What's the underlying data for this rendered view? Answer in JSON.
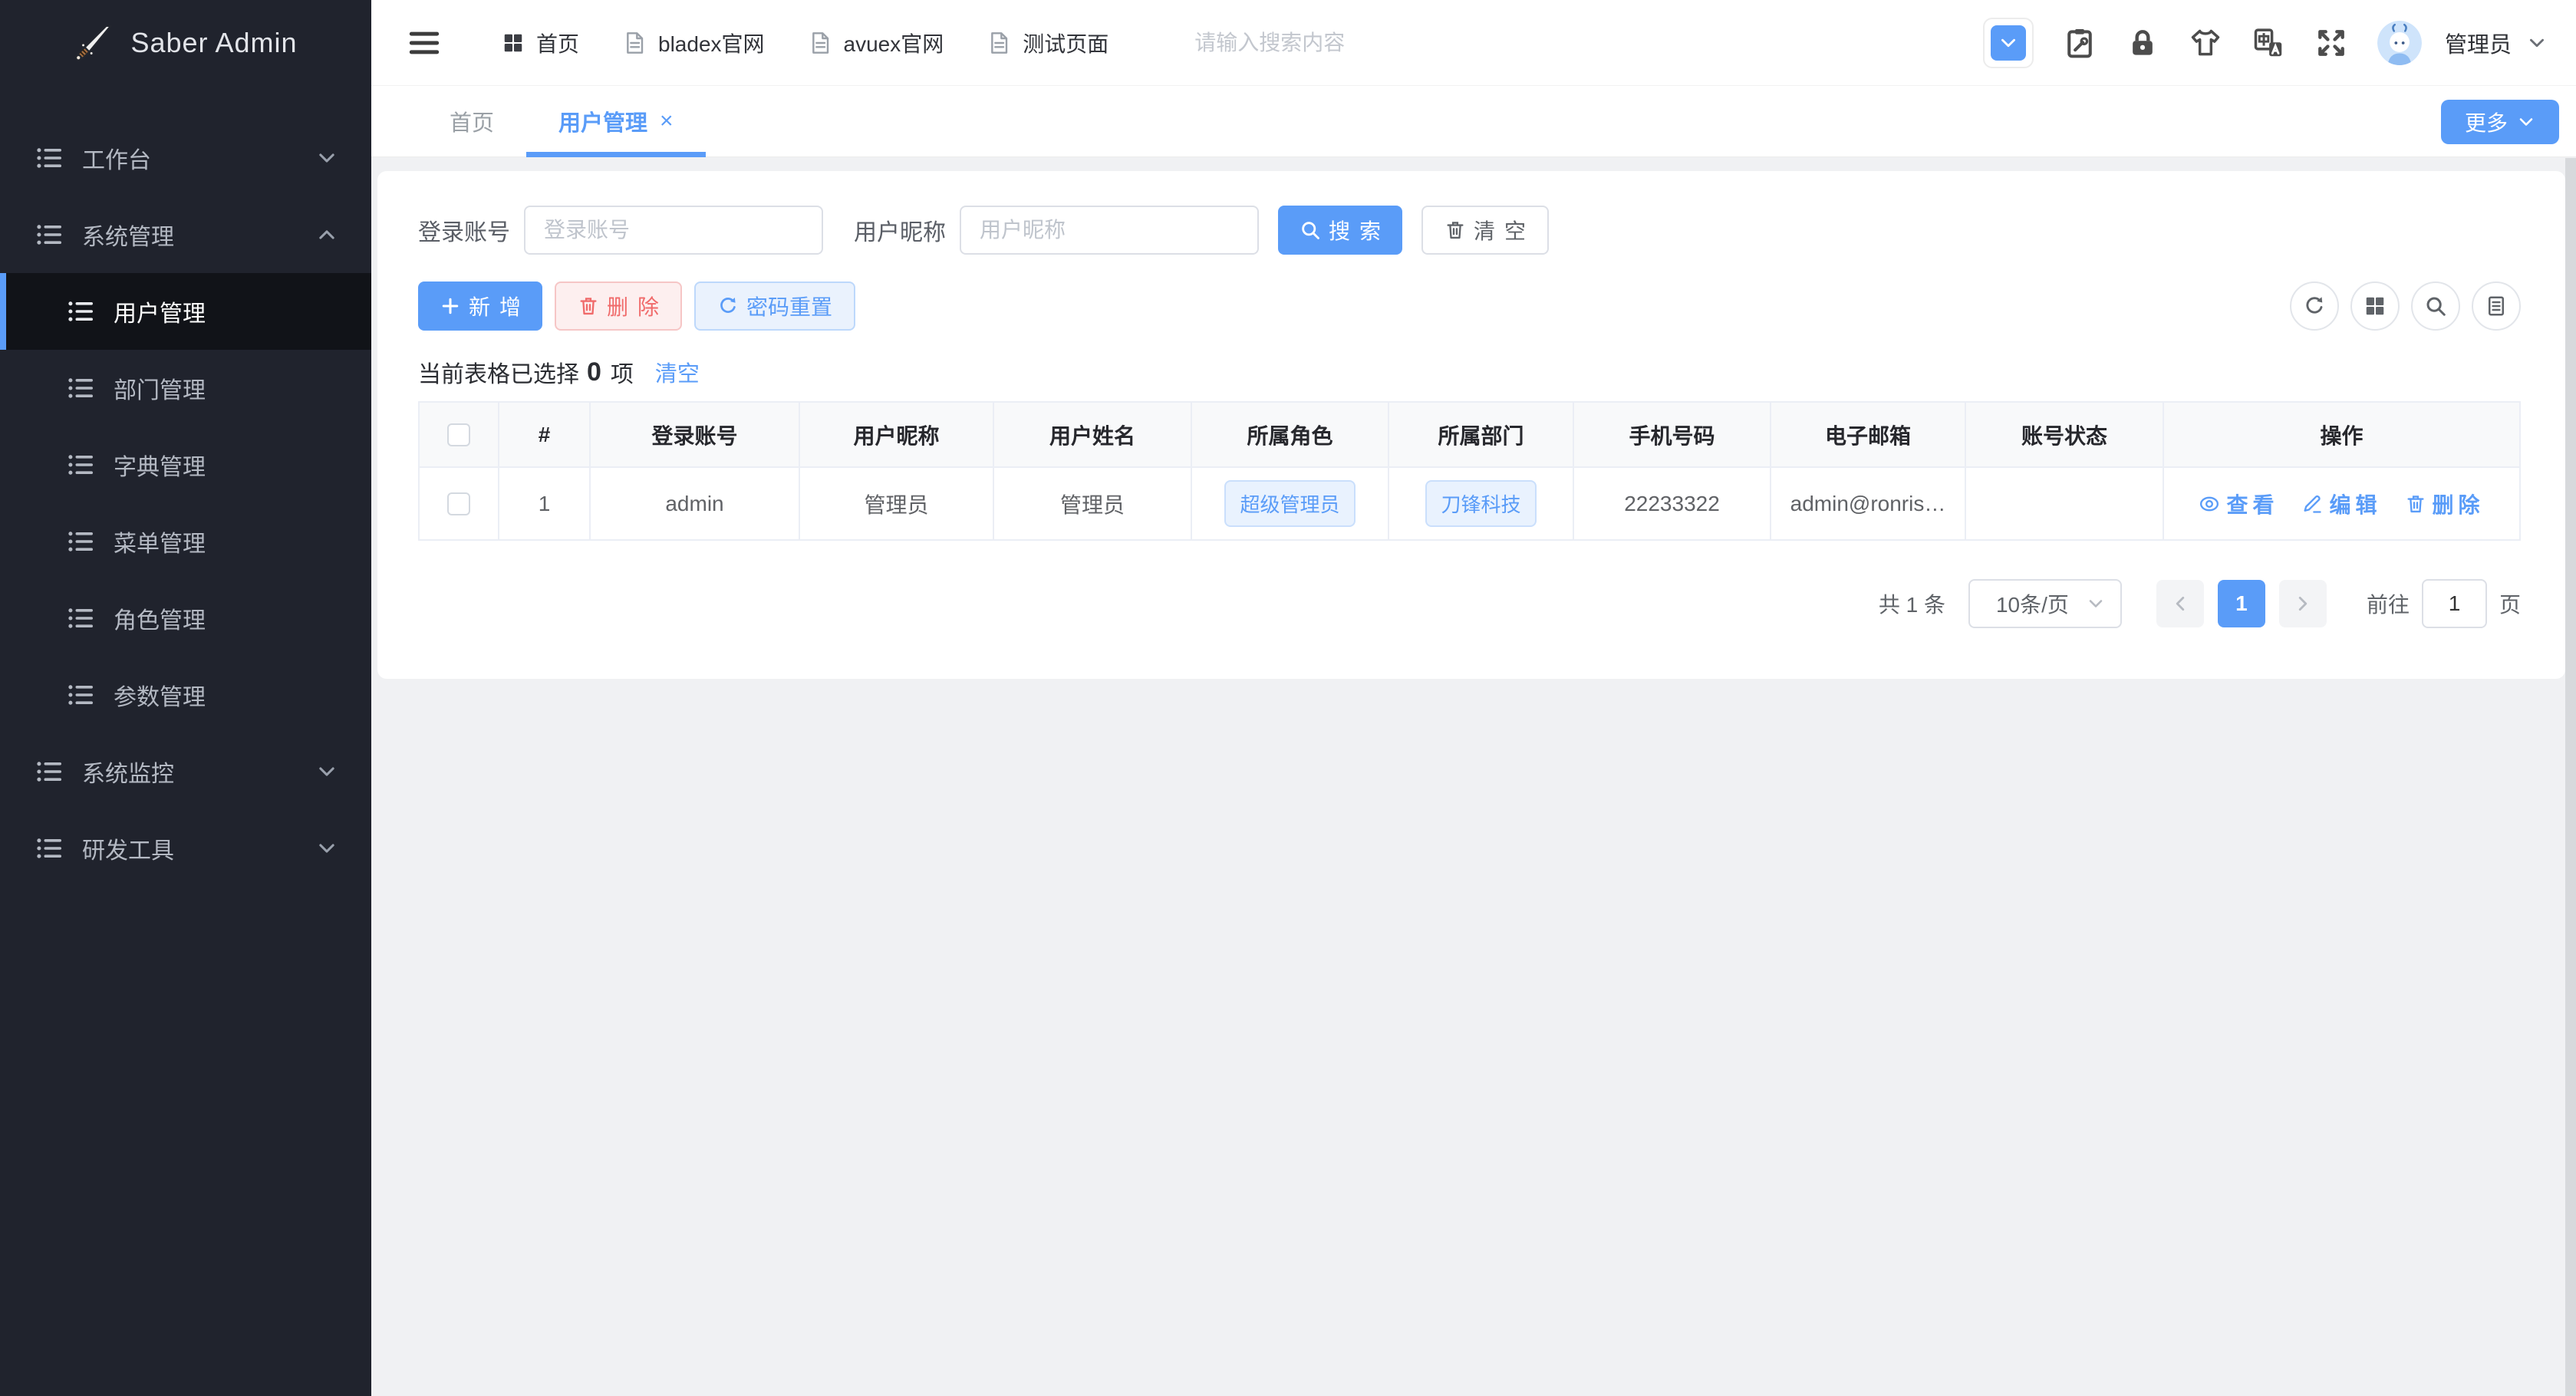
{
  "app": {
    "logo_text": "Saber Admin"
  },
  "colors": {
    "accent": "#5a9cf8",
    "danger": "#f06a6a",
    "sidebar_bg": "#20232d",
    "sidebar_active_bg": "#111318"
  },
  "sidebar": {
    "items": [
      {
        "label": "工作台"
      },
      {
        "label": "系统管理"
      },
      {
        "label": "用户管理"
      },
      {
        "label": "部门管理"
      },
      {
        "label": "字典管理"
      },
      {
        "label": "菜单管理"
      },
      {
        "label": "角色管理"
      },
      {
        "label": "参数管理"
      },
      {
        "label": "系统监控"
      },
      {
        "label": "研发工具"
      }
    ]
  },
  "topbar": {
    "nav": [
      {
        "label": "首页"
      },
      {
        "label": "bladex官网"
      },
      {
        "label": "avuex官网"
      },
      {
        "label": "测试页面"
      }
    ],
    "search_placeholder": "请输入搜索内容",
    "user": {
      "name": "管理员"
    }
  },
  "tabs": {
    "home": "首页",
    "active": "用户管理",
    "close_glyph": "×",
    "more": "更多"
  },
  "filter": {
    "account_label": "登录账号",
    "account_placeholder": "登录账号",
    "nickname_label": "用户昵称",
    "nickname_placeholder": "用户昵称",
    "search_button": "搜索",
    "clear_button": "清空"
  },
  "toolbar": {
    "add": "新增",
    "delete": "删除",
    "reset_password": "密码重置"
  },
  "selection": {
    "prefix": "当前表格已选择",
    "count": "0",
    "suffix": "项",
    "clear": "清空"
  },
  "table": {
    "headers": {
      "index": "#",
      "account": "登录账号",
      "nickname": "用户昵称",
      "name": "用户姓名",
      "role": "所属角色",
      "dept": "所属部门",
      "phone": "手机号码",
      "email": "电子邮箱",
      "status": "账号状态",
      "actions": "操作"
    },
    "rows": [
      {
        "index": "1",
        "account": "admin",
        "nickname": "管理员",
        "name": "管理员",
        "role": "超级管理员",
        "dept": "刀锋科技",
        "phone": "22233322",
        "email": "admin@ronris…",
        "status": "",
        "view": "查看",
        "edit": "编辑",
        "delete": "删除"
      }
    ]
  },
  "pagination": {
    "total": "共 1 条",
    "page_size": "10条/页",
    "page": "1",
    "goto_label": "前往",
    "goto_value": "1",
    "unit": "页"
  }
}
